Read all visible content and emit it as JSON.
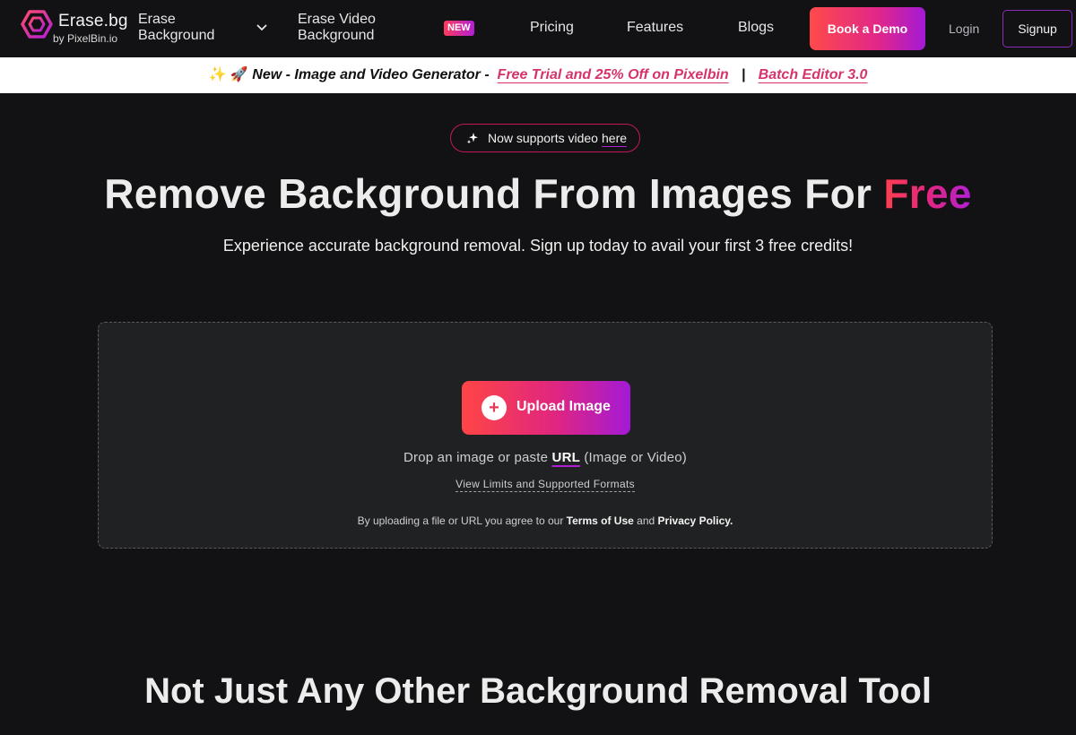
{
  "nav": {
    "brand_name": "Erase.bg",
    "brand_sub": "by PixelBin.io",
    "erase_background": "Erase Background",
    "erase_video": "Erase Video Background",
    "new_badge": "NEW",
    "pricing": "Pricing",
    "features": "Features",
    "blogs": "Blogs",
    "book_demo": "Book a Demo",
    "login": "Login",
    "signup": "Signup"
  },
  "announcement": {
    "emojis": "✨ 🚀",
    "text": "New - Image and Video Generator -",
    "link1": "Free Trial and 25% Off on Pixelbin",
    "separator": "|",
    "link2": "Batch Editor 3.0"
  },
  "hero": {
    "pill_text": "Now supports video",
    "pill_link": "here",
    "title_main": "Remove Background From Images For",
    "title_highlight": "Free",
    "subtitle": "Experience accurate background removal. Sign up today to avail your first 3 free credits!"
  },
  "upload": {
    "button_label": "Upload Image",
    "drop_prefix": "Drop an image or paste",
    "drop_url": "URL",
    "drop_suffix": "(Image or Video)",
    "limits_link": "View Limits and Supported Formats",
    "legal_prefix": "By uploading a file or URL you agree to our",
    "terms": "Terms of Use",
    "legal_and": "and",
    "privacy": "Privacy Policy."
  },
  "section": {
    "title": "Not Just Any Other Background Removal Tool"
  },
  "colors": {
    "background": "#121214",
    "accent_start": "#ff4545",
    "accent_end": "#a31ad6",
    "announcement_link": "#d6336c",
    "upload_panel": "#202122"
  }
}
